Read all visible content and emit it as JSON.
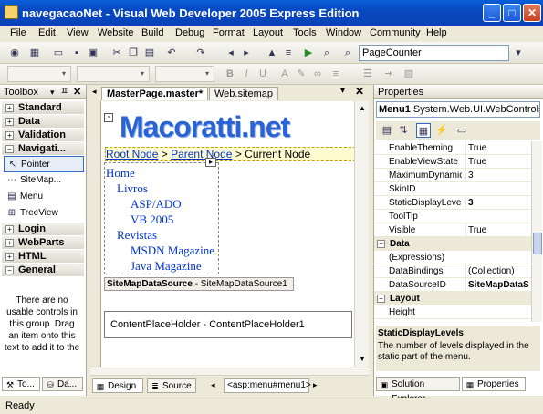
{
  "window": {
    "title": "navegacaoNet - Visual Web Developer 2005 Express Edition"
  },
  "menu": [
    "File",
    "Edit",
    "View",
    "Website",
    "Build",
    "Debug",
    "Format",
    "Layout",
    "Tools",
    "Window",
    "Community",
    "Help"
  ],
  "toolbar": {
    "target_combo": "PageCounter"
  },
  "toolbox": {
    "title": "Toolbox",
    "categories": [
      {
        "label": "Standard",
        "sign": "+"
      },
      {
        "label": "Data",
        "sign": "+"
      },
      {
        "label": "Validation",
        "sign": "+"
      },
      {
        "label": "Navigati...",
        "sign": "−"
      },
      {
        "label": "Login",
        "sign": "+"
      },
      {
        "label": "WebParts",
        "sign": "+"
      },
      {
        "label": "HTML",
        "sign": "+"
      },
      {
        "label": "General",
        "sign": "−"
      }
    ],
    "nav_items": [
      "Pointer",
      "SiteMap...",
      "Menu",
      "TreeView"
    ],
    "empty_message": "There are no usable controls in this group. Drag an item onto this text to add it to the",
    "bottom_tabs": [
      "To...",
      "Da..."
    ]
  },
  "document": {
    "tabs": [
      "MasterPage.master*",
      "Web.sitemap"
    ],
    "logo": "Macoratti.net",
    "sitemappath": {
      "root": "Root Node",
      "sep1": ">",
      "parent": "Parent Node",
      "sep2": ">",
      "current": "Current Node"
    },
    "menu_items": [
      "Home",
      "Livros",
      "ASP/ADO",
      "VB 2005",
      "Revistas",
      "MSDN Magazine",
      "Java Magazine"
    ],
    "datasource_label": "SiteMapDataSource",
    "datasource_id": "- SiteMapDataSource1",
    "content_placeholder": "ContentPlaceHolder - ContentPlaceHolder1",
    "view_design": "Design",
    "view_source": "Source",
    "tag_navigator": "<asp:menu#menu1>"
  },
  "properties": {
    "title": "Properties",
    "object": "Menu1",
    "object_type": "System.Web.UI.WebControls",
    "rows": [
      {
        "name": "EnableTheming",
        "value": "True"
      },
      {
        "name": "EnableViewState",
        "value": "True"
      },
      {
        "name": "MaximumDynamicD",
        "value": "3"
      },
      {
        "name": "SkinID",
        "value": ""
      },
      {
        "name": "StaticDisplayLevels",
        "value": "3"
      },
      {
        "name": "ToolTip",
        "value": ""
      },
      {
        "name": "Visible",
        "value": "True"
      }
    ],
    "data_category": "Data",
    "data_rows": [
      {
        "name": "(Expressions)",
        "value": ""
      },
      {
        "name": "DataBindings",
        "value": "(Collection)"
      },
      {
        "name": "DataSourceID",
        "value": "SiteMapDataS"
      }
    ],
    "layout_category": "Layout",
    "layout_rows": [
      {
        "name": "Height",
        "value": ""
      }
    ],
    "desc_title": "StaticDisplayLevels",
    "desc_text": "The number of levels displayed in the static part of the menu.",
    "bottom_tabs": [
      "Solution Explorer",
      "Properties"
    ]
  },
  "status": "Ready"
}
